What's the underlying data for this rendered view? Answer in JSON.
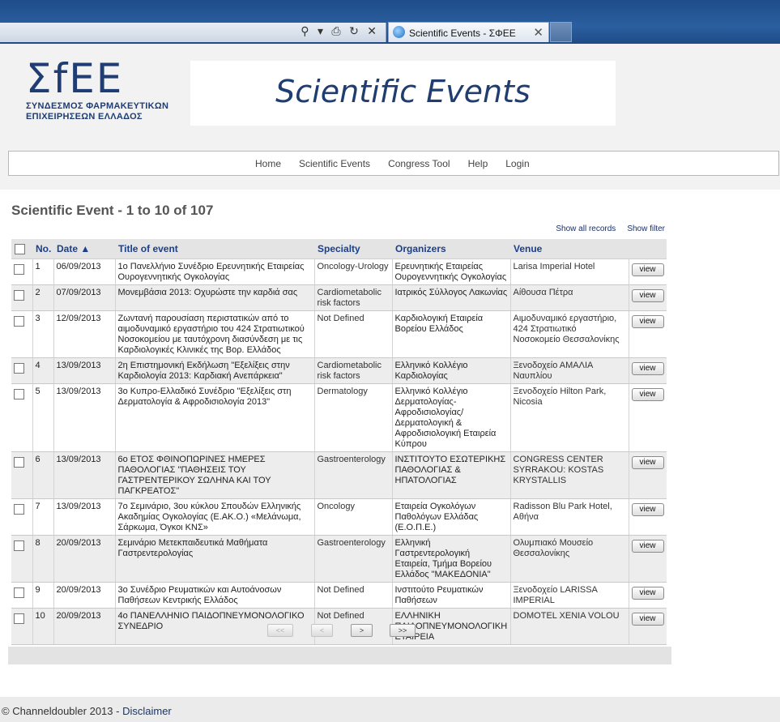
{
  "browser": {
    "address_icons": "⚲ ▾ ⎙ ↻ ✕",
    "tab_title": "Scientific Events - ΣΦΕΕ",
    "tab_close": "✕"
  },
  "logo": {
    "mark": "ΣfΕΕ",
    "line1": "ΣΥΝΔΕΣΜΟΣ ΦΑΡΜΑΚΕΥΤΙΚΩΝ",
    "line2": "ΕΠΙΧΕΙΡΗΣΕΩΝ ΕΛΛΑΔΟΣ"
  },
  "banner": {
    "text": "Scientific Events"
  },
  "nav": {
    "items": [
      "Home",
      "Scientific Events",
      "Congress Tool",
      "Help",
      "Login"
    ]
  },
  "main": {
    "title": "Scientific Event - 1 to 10 of 107",
    "show_all": "Show all records",
    "show_filter": "Show filter"
  },
  "table": {
    "headers": {
      "no": "No.",
      "date": "Date ▲",
      "title": "Title of event",
      "specialty": "Specialty",
      "organizers": "Organizers",
      "venue": "Venue"
    },
    "view_label": "view",
    "rows": [
      {
        "no": "1",
        "date": "06/09/2013",
        "title": "1ο Πανελλήνιο Συνέδριο Ερευνητικής Εταιρείας Ουρογεννητικής Ογκολογίας",
        "specialty": "Oncology-Urology",
        "organizers": "Ερευνητικής Εταιρείας Ουρογεννητικής Ογκολογίας",
        "venue": "Larisa Imperial Hotel"
      },
      {
        "no": "2",
        "date": "07/09/2013",
        "title": "Μονεμβάσια 2013: Οχυρώστε την καρδιά σας",
        "specialty": "Cardiometabolic risk factors",
        "organizers": "Ιατρικός Σύλλογος Λακωνίας",
        "venue": "Αίθουσα Πέτρα"
      },
      {
        "no": "3",
        "date": "12/09/2013",
        "title": "Ζωντανή παρουσίαση περιστατικών από το αιμοδυναμικό εργαστήριο του 424 Στρατιωτικού Νοσοκομείου με ταυτόχρονη διασύνδεση με τις Καρδιολογικές Κλινικές της Βορ. Ελλάδος",
        "specialty": "Not Defined",
        "organizers": "Καρδιολογική Εταιρεία Βορείου Ελλάδος",
        "venue": "Αιμοδυναμικό εργαστήριο, 424 Στρατιωτικό Νοσοκομείο Θεσσαλονίκης"
      },
      {
        "no": "4",
        "date": "13/09/2013",
        "title": "2η Επιστημονική Εκδήλωση \"Εξελίξεις στην Καρδιολογία 2013: Καρδιακή Ανεπάρκεια\"",
        "specialty": "Cardiometabolic risk factors",
        "organizers": "Ελληνικό Κολλέγιο Καρδιολογίας",
        "venue": "Ξενοδοχείο ΑΜΑΛΙΑ Ναυπλίου"
      },
      {
        "no": "5",
        "date": "13/09/2013",
        "title": "3ο Κυπρο-Ελλαδικό Συνέδριο \"Εξελίξεις στη Δερματολογία & Αφροδισιολογία 2013\"",
        "specialty": "Dermatology",
        "organizers": "Ελληνικό Κολλέγιο Δερματολογίας-Αφροδισιολογίας/Δερματολογική & Αφροδισιολογική Εταιρεία Κύπρου",
        "venue": "Ξενοδοχείο Hilton Park, Nicosia"
      },
      {
        "no": "6",
        "date": "13/09/2013",
        "title": "6ο ΕΤΟΣ ΦΘΙΝΟΠΩΡΙΝΕΣ ΗΜΕΡΕΣ ΠΑΘΟΛΟΓΙΑΣ \"ΠΑΘΗΣΕΙΣ ΤΟΥ ΓΑΣΤΡΕΝΤΕΡΙΚΟΥ ΣΩΛΗΝΑ ΚΑΙ ΤΟΥ ΠΑΓΚΡΕΑΤΟΣ\"",
        "specialty": "Gastroenterology",
        "organizers": "ΙΝΣΤΙΤΟΥΤΟ ΕΣΩΤΕΡΙΚΗΣ ΠΑΘΟΛΟΓΙΑΣ & ΗΠΑΤΟΛΟΓΙΑΣ",
        "venue": "CONGRESS CENTER SYRRAKOU: KOSTAS KRYSTALLIS"
      },
      {
        "no": "7",
        "date": "13/09/2013",
        "title": "7ο Σεμινάριο, 3ου κύκλου Σπουδών Ελληνικής Ακαδημίας Ογκολογίας (Ε.ΑΚ.Ο.) «Μελάνωμα, Σάρκωμα, Όγκοι ΚΝΣ»",
        "specialty": "Oncology",
        "organizers": "Εταιρεία Ογκολόγων Παθολόγων Ελλάδας (Ε.Ο.Π.Ε.)",
        "venue": "Radisson Blu Park Hotel, Αθήνα"
      },
      {
        "no": "8",
        "date": "20/09/2013",
        "title": "Σεμινάριο Μετεκπαιδευτικά Μαθήματα Γαστρεντερολογίας",
        "specialty": "Gastroenterology",
        "organizers": "Ελληνική Γαστρεντερολογική Εταιρεία, Τμήμα Βορείου Ελλάδος \"ΜΑΚΕΔΟΝΙΑ\"",
        "venue": "Ολυμπιακό Μουσείο Θεσσαλονίκης"
      },
      {
        "no": "9",
        "date": "20/09/2013",
        "title": "3ο Συνέδριο Ρευματικών και Αυτοάνοσων Παθήσεων Κεντρικής Ελλάδος",
        "specialty": "Not Defined",
        "organizers": "Ινστιτούτο Ρευματικών Παθήσεων",
        "venue": "Ξενοδοχείο LARISSA IMPERIAL"
      },
      {
        "no": "10",
        "date": "20/09/2013",
        "title": "4ο ΠΑΝΕΛΛΗΝΙΟ ΠΑΙΔΟΠΝΕΥΜΟΝΟΛΟΓΙΚΟ ΣΥΝΕΔΡΙΟ",
        "specialty": "Not Defined",
        "organizers": "ΕΛΛΗΝΙΚΗ ΠΑΙΔΟΠΝΕΥΜΟΝΟΛΟΓΙΚΗ ΕΤΑΙΡΕΙΑ",
        "venue": "DOMOTEL XENIA VOLOU"
      }
    ]
  },
  "pager": {
    "first": "<<",
    "prev": "<",
    "next": ">",
    "last": ">>"
  },
  "footer": {
    "copyright": "© Channeldoubler 2013 - ",
    "disclaimer": "Disclaimer"
  }
}
